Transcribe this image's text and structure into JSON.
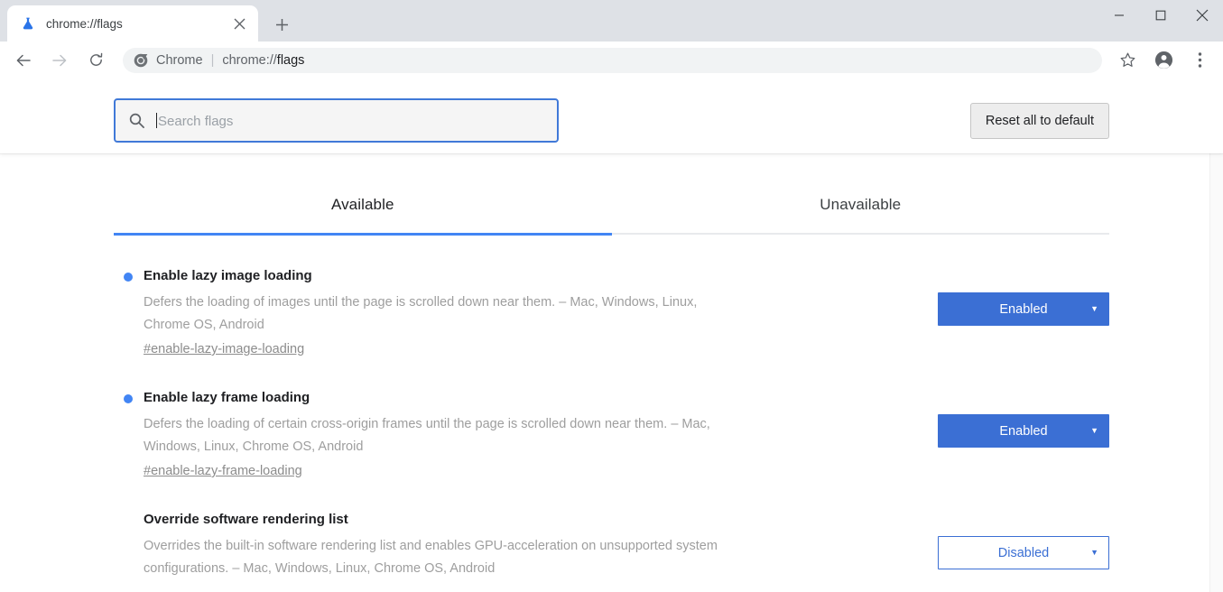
{
  "window": {
    "controls": [
      {
        "name": "minimize",
        "glyph": "—"
      },
      {
        "name": "maximize",
        "glyph": "□"
      },
      {
        "name": "close",
        "glyph": "✕"
      }
    ]
  },
  "tabstrip": {
    "tab_title": "chrome://flags",
    "favicon": "flask-icon",
    "close_glyph": "✕",
    "newtab_glyph": "+"
  },
  "toolbar": {
    "back_icon": "back-arrow-icon",
    "forward_icon": "forward-arrow-icon",
    "reload_icon": "reload-icon",
    "omnibox": {
      "scheme_label": "Chrome",
      "separator": "|",
      "url_prefix": "chrome://",
      "url_emphasis": "flags"
    },
    "bookmark_icon": "star-icon",
    "profile_icon": "account-icon",
    "menu_icon": "three-dot-menu-icon"
  },
  "search": {
    "placeholder": "Search flags",
    "icon": "search-icon",
    "value": "",
    "focused": true
  },
  "reset": {
    "label": "Reset all to default"
  },
  "tabs": [
    {
      "label": "Available",
      "active": true
    },
    {
      "label": "Unavailable",
      "active": false
    }
  ],
  "flags": [
    {
      "name": "Enable lazy image loading",
      "description": "Defers the loading of images until the page is scrolled down near them. – Mac, Windows, Linux, Chrome OS, Android",
      "id": "#enable-lazy-image-loading",
      "modified": true,
      "select": {
        "value": "Enabled",
        "state": "enabled",
        "arrow": "▼"
      }
    },
    {
      "name": "Enable lazy frame loading",
      "description": "Defers the loading of certain cross-origin frames until the page is scrolled down near them. – Mac, Windows, Linux, Chrome OS, Android",
      "id": "#enable-lazy-frame-loading",
      "modified": true,
      "select": {
        "value": "Enabled",
        "state": "enabled",
        "arrow": "▼"
      }
    },
    {
      "name": "Override software rendering list",
      "description": "Overrides the built-in software rendering list and enables GPU-acceleration on unsupported system configurations. – Mac, Windows, Linux, Chrome OS, Android",
      "id": "",
      "modified": false,
      "select": {
        "value": "Disabled",
        "state": "disabled",
        "arrow": "▼"
      }
    }
  ],
  "scrollbar": {
    "up_arrow": "▲"
  },
  "colors": {
    "accent": "#4285f4",
    "select_blue": "#3b6fd4",
    "tabstrip_bg": "#dee1e6",
    "focus_border": "#4079d8"
  }
}
